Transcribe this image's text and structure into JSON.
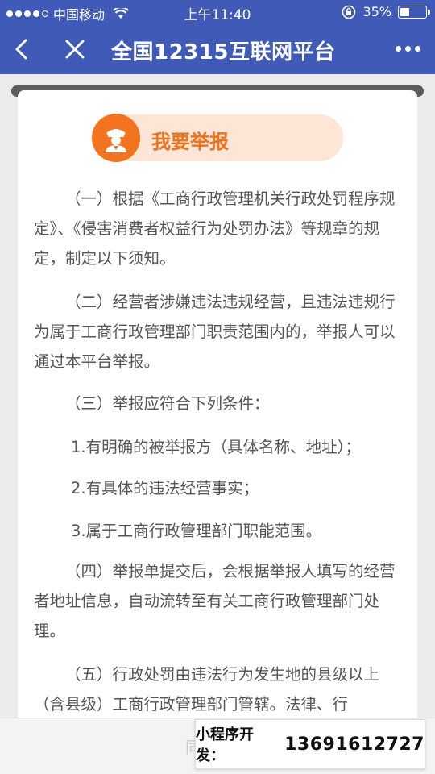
{
  "status_bar": {
    "carrier": "中国移动",
    "time": "上午11:40",
    "battery_percent": "35%",
    "battery_level": 0.35
  },
  "nav": {
    "title": "全国12315互联网平台",
    "back_icon": "chevron-left-icon",
    "close_icon": "close-icon",
    "more_icon": "more-dots-icon"
  },
  "header": {
    "report_label": "我要举报",
    "icon": "officer-icon"
  },
  "content": {
    "p1": "（一）根据《工商行政管理机关行政处罚程序规定》、《侵害消费者权益行为处罚办法》等规章的规定，制定以下须知。",
    "p2": "（二）经营者涉嫌违法违规经营，且违法违规行为属于工商行政管理部门职责范围内的，举报人可以通过本平台举报。",
    "p3": "（三）举报应符合下列条件：",
    "item1": "1.有明确的被举报方（具体名称、地址）；",
    "item2": "2.有具体的违法经营事实；",
    "item3": "3.属于工商行政管理部门职能范围。",
    "p4": "（四）举报单提交后，会根据举报人填写的经营者地址信息，自动流转至有关工商行政管理部门处理。",
    "p5": "（五）行政处罚由违法行为发生地的县级以上（含县级）工商行政管理部门管辖。法律、行"
  },
  "bottom": {
    "hint": "同",
    "promo_label": "小程序开发：",
    "promo_phone": "13691612727"
  },
  "colors": {
    "nav_bg": "#3f5bb7",
    "accent_orange": "#f3731f",
    "pill_bg": "#fde6d6"
  }
}
